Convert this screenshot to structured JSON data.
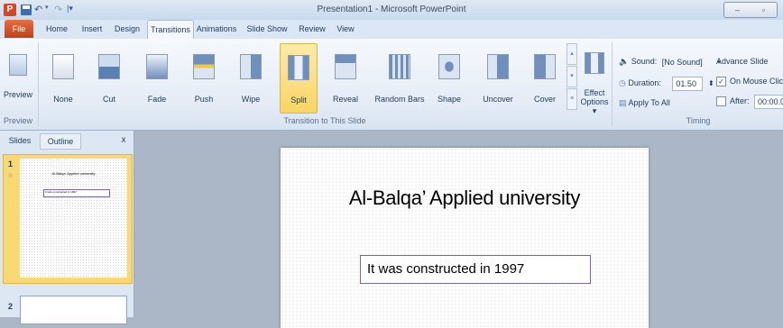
{
  "window": {
    "title": "Presentation1 - Microsoft PowerPoint",
    "min_glyph": "–",
    "max_glyph": "▫"
  },
  "tabs": [
    "File",
    "Home",
    "Insert",
    "Design",
    "Transitions",
    "Animations",
    "Slide Show",
    "Review",
    "View"
  ],
  "ribbon": {
    "preview": {
      "button": "Preview",
      "group": "Preview"
    },
    "transitions": [
      "None",
      "Cut",
      "Fade",
      "Push",
      "Wipe",
      "Split",
      "Reveal",
      "Random Bars",
      "Shape",
      "Uncover",
      "Cover"
    ],
    "effect_options": {
      "line1": "Effect",
      "line2": "Options ▾"
    },
    "group_transition": "Transition to This Slide",
    "timing": {
      "sound_label": "Sound:",
      "sound_value": "[No Sound]",
      "duration_label": "Duration:",
      "duration_value": "01.50",
      "apply_all": "Apply To All",
      "advance_title": "Advance Slide",
      "on_mouse_click": "On Mouse Click",
      "after_label": "After:",
      "after_value": "00:00.00",
      "group": "Timing"
    }
  },
  "left_panel": {
    "tab_slides": "Slides",
    "tab_outline": "Outline",
    "close": "x",
    "slide1_number": "1",
    "slide2_number": "2",
    "thumb_title": "Al-Balqa’ Applied university",
    "thumb_text": "It was constructed in 1997"
  },
  "slide": {
    "title": "Al-Balqa’ Applied university",
    "body": "It was constructed in 1997"
  }
}
